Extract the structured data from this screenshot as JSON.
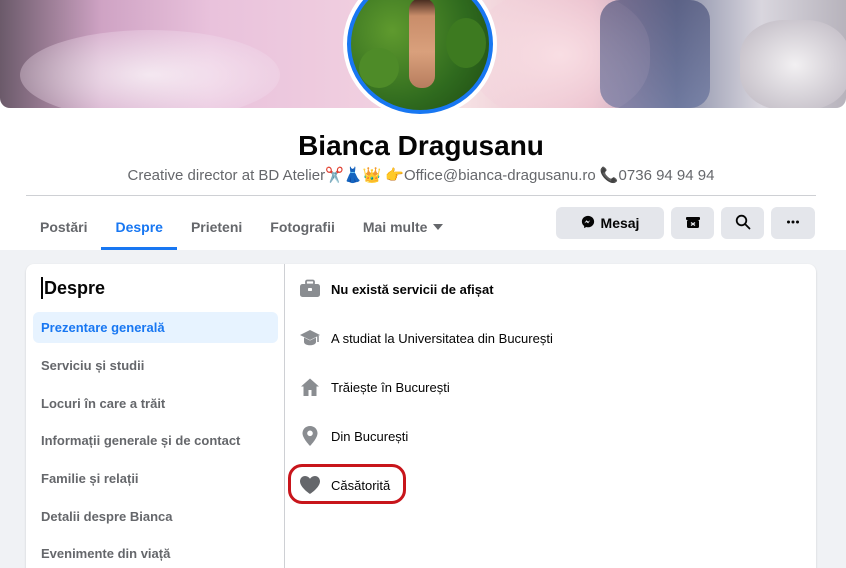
{
  "profile": {
    "name": "Bianca Dragusanu",
    "bio": "Creative director at BD Atelier✂️👗👑 👉Office@bianca-dragusanu.ro 📞0736 94 94 94"
  },
  "tabs": [
    {
      "label": "Postări"
    },
    {
      "label": "Despre"
    },
    {
      "label": "Prieteni"
    },
    {
      "label": "Fotografii"
    },
    {
      "label": "Mai multe"
    }
  ],
  "actions": {
    "message_label": "Mesaj"
  },
  "about": {
    "title": "Despre",
    "nav": [
      {
        "label": "Prezentare generală"
      },
      {
        "label": "Serviciu și studii"
      },
      {
        "label": "Locuri în care a trăit"
      },
      {
        "label": "Informații generale și de contact"
      },
      {
        "label": "Familie și relații"
      },
      {
        "label": "Detalii despre Bianca"
      },
      {
        "label": "Evenimente din viață"
      }
    ],
    "overview": [
      {
        "text": "Nu există servicii de afișat",
        "icon": "briefcase-icon"
      },
      {
        "text": "A studiat la Universitatea din București",
        "icon": "graduation-cap-icon"
      },
      {
        "text": "Trăiește în București",
        "icon": "home-icon"
      },
      {
        "text": "Din București",
        "icon": "location-pin-icon"
      },
      {
        "text": "Căsătorită",
        "icon": "heart-icon"
      }
    ]
  },
  "colors": {
    "accent": "#1877f2",
    "highlight_circle": "#c8151b"
  }
}
